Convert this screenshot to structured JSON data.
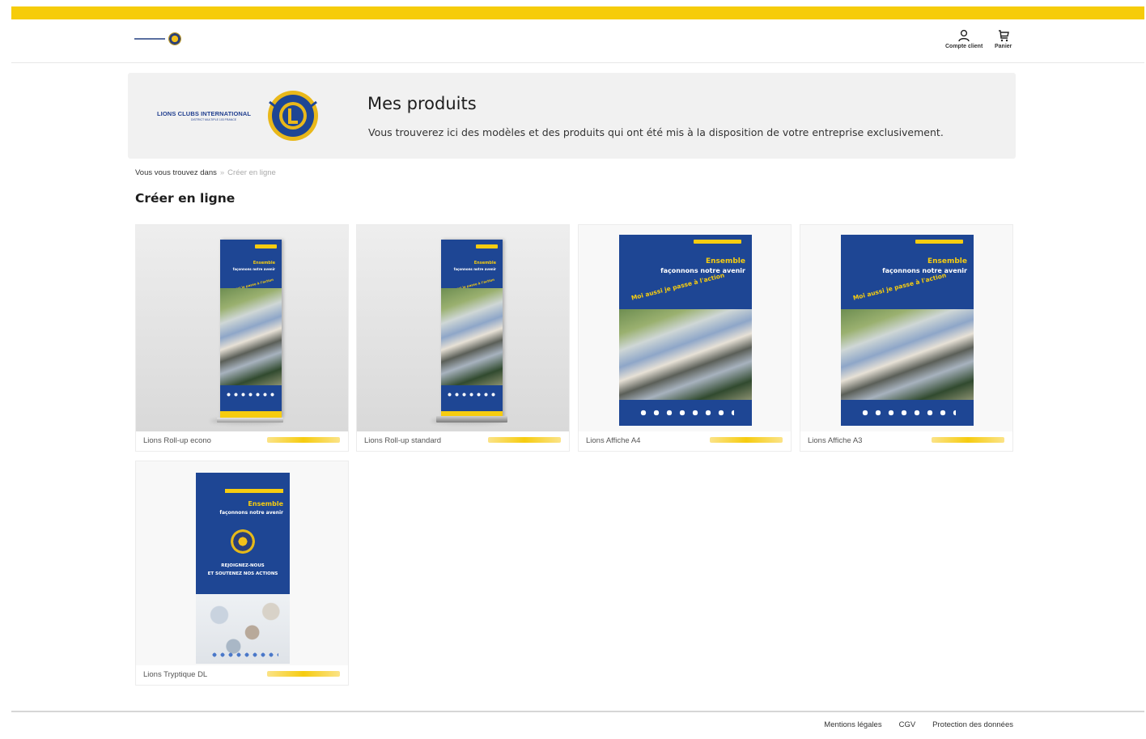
{
  "header": {
    "account_label": "Compte client",
    "cart_label": "Panier"
  },
  "hero": {
    "brand_name": "LIONS CLUBS INTERNATIONAL",
    "brand_sub": "DISTRICT MULTIPLE 103 FRANCE",
    "title": "Mes produits",
    "description": "Vous trouverez ici des modèles et des produits qui ont été mis à la disposition de votre entreprise exclusivement."
  },
  "breadcrumb": {
    "lead": "Vous vous trouvez dans",
    "separator": "»",
    "current": "Créer en ligne"
  },
  "section": {
    "title": "Créer en ligne"
  },
  "poster_text": {
    "tag_main": "Ensemble",
    "tag_sub": "façonnons notre avenir",
    "slant": "Moi aussi je passe à l'action",
    "join_1": "REJOIGNEZ-NOUS",
    "join_2": "ET SOUTENEZ NOS ACTIONS"
  },
  "products": [
    {
      "name": "Lions Roll-up econo"
    },
    {
      "name": "Lions Roll-up standard"
    },
    {
      "name": "Lions Affiche A4"
    },
    {
      "name": "Lions Affiche A3"
    },
    {
      "name": "Lions Tryptique DL"
    }
  ],
  "footer": {
    "links": [
      "Mentions légales",
      "CGV",
      "Protection des données"
    ]
  },
  "colors": {
    "accent_yellow": "#f6cc0a",
    "lions_blue": "#1e4694"
  }
}
